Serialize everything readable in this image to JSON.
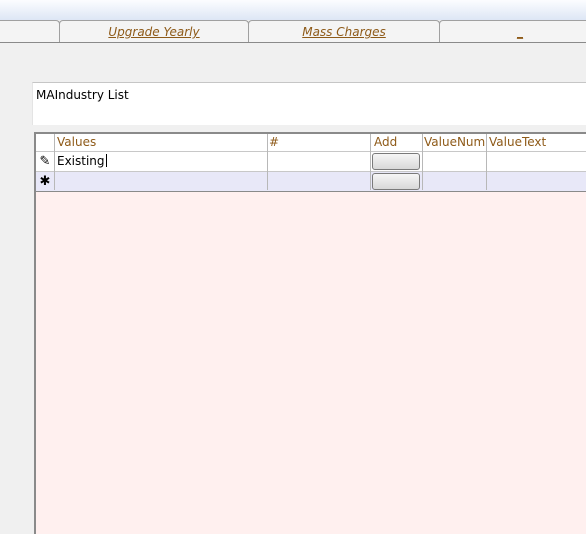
{
  "tabs": [
    {
      "label": "Upgrade Yearly"
    },
    {
      "label": "Mass Charges"
    },
    {
      "label": "_"
    }
  ],
  "list": {
    "title": "MAIndustry List"
  },
  "grid": {
    "columns": [
      "Values",
      "#",
      "Add",
      "ValueNum",
      "ValueText"
    ],
    "rows": [
      {
        "selector_icon": "pencil-icon",
        "selector_glyph": "✎",
        "value": "Existing"
      },
      {
        "selector_icon": "new-record-icon",
        "selector_glyph": "✱",
        "value": ""
      }
    ]
  },
  "colors": {
    "tab_link": "#8e5a18",
    "grid_background": "#fff0ef",
    "new_row": "#e8e8f8"
  }
}
